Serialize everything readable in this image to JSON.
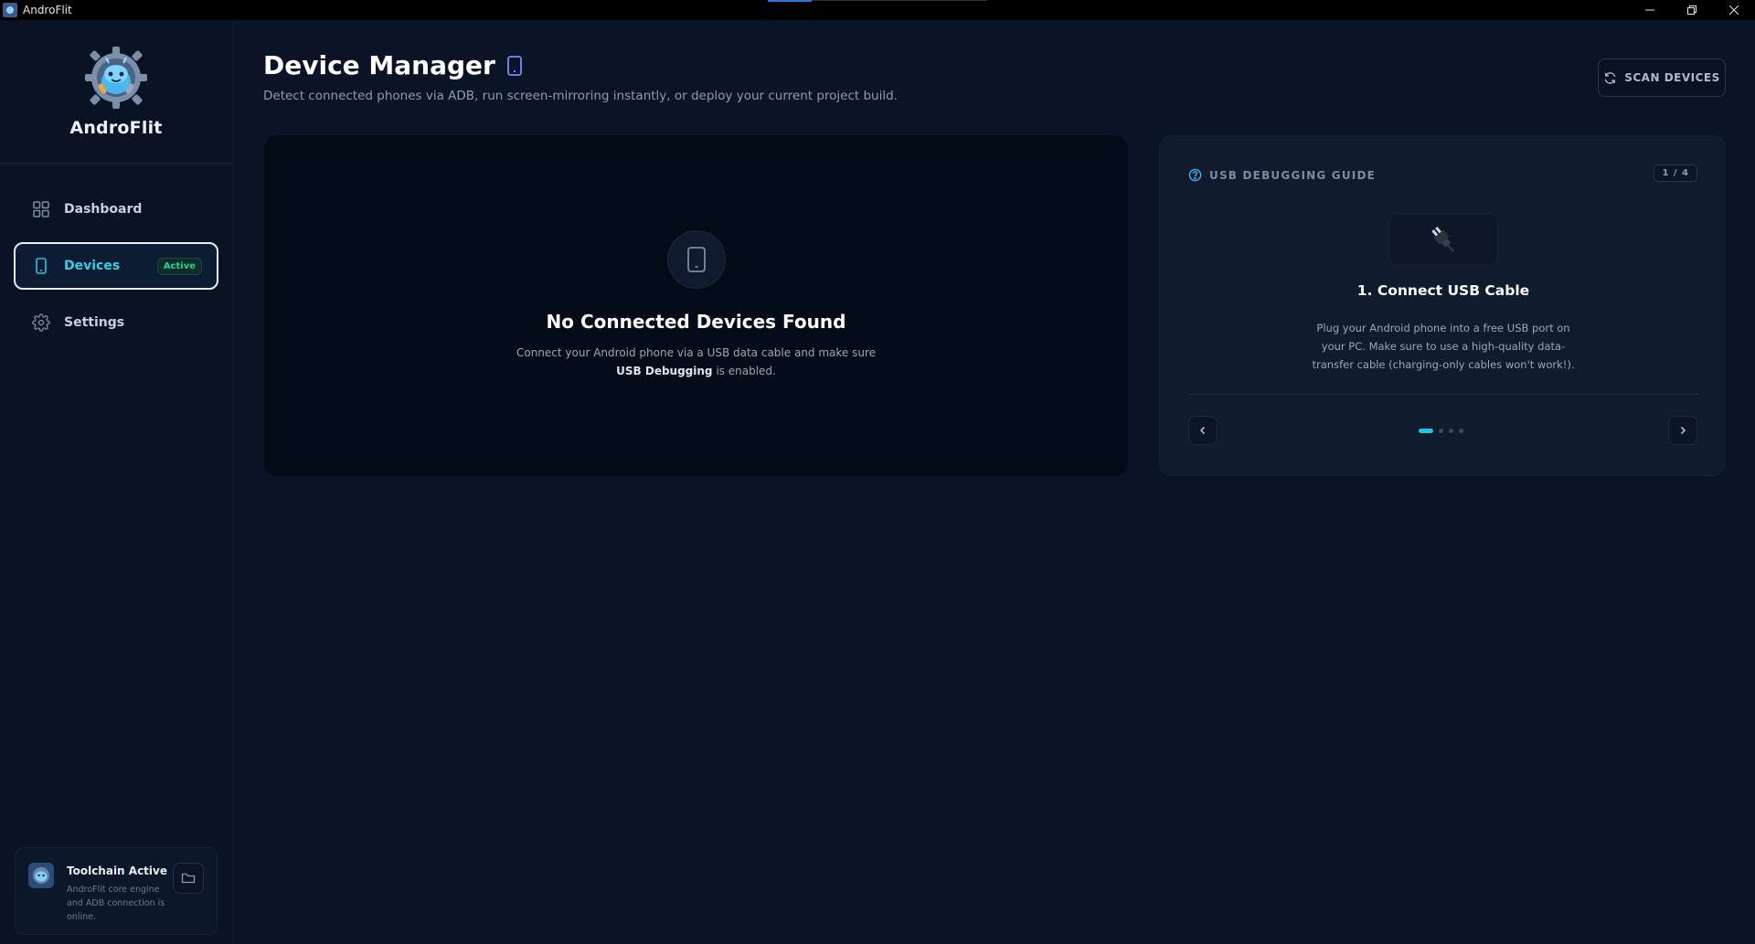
{
  "window": {
    "title": "AndroFlit"
  },
  "sidebar": {
    "brand": "AndroFlit",
    "items": [
      {
        "label": "Dashboard",
        "icon": "dashboard-grid-icon"
      },
      {
        "label": "Devices",
        "icon": "phone-icon",
        "badge": "Active",
        "active": true
      },
      {
        "label": "Settings",
        "icon": "gear-icon"
      }
    ],
    "toolchain": {
      "title": "Toolchain Active",
      "description": "AndroFlit core engine and ADB connection is online."
    }
  },
  "header": {
    "title": "Device Manager",
    "subtitle": "Detect connected phones via ADB, run screen-mirroring instantly, or deploy your current project build.",
    "scan_label": "SCAN DEVICES"
  },
  "empty_state": {
    "title": "No Connected Devices Found",
    "desc_before": "Connect your Android phone via a USB data cable and make sure ",
    "desc_bold": "USB Debugging",
    "desc_after": " is enabled."
  },
  "guide": {
    "heading": "USB DEBUGGING GUIDE",
    "step_counter": "1 / 4",
    "step_title": "1. Connect USB Cable",
    "step_desc": "Plug your Android phone into a free USB port on your PC. Make sure to use a high-quality data-transfer cable (charging-only cables won't work!).",
    "total_steps": 4,
    "current_step": 1
  },
  "colors": {
    "accent": "#1ec6e6",
    "active_badge": "#18d88f",
    "background": "#0b1426"
  }
}
